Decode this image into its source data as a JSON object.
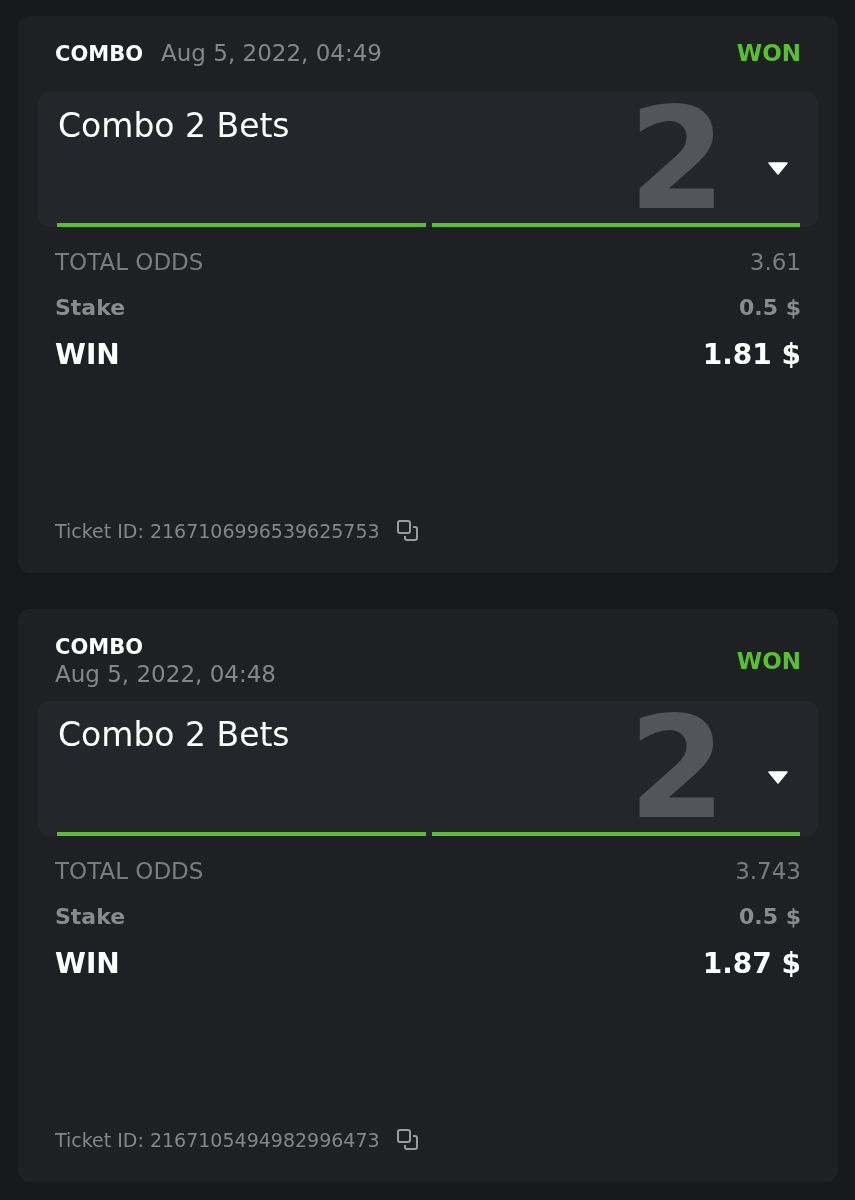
{
  "bets": [
    {
      "type": "COMBO",
      "date": "Aug 5, 2022, 04:49",
      "date_on_new_line": false,
      "status": "WON",
      "title": "Combo 2 Bets",
      "count": "2",
      "expanded": false,
      "legs": [
        {
          "won": true
        },
        {
          "won": true
        }
      ],
      "total_odds_label": "TOTAL ODDS",
      "total_odds": "3.61",
      "stake_label": "Stake",
      "stake": "0.5 $",
      "win_label": "WIN",
      "win": "1.81 $",
      "ticket": "Ticket ID: 2167106996539625753"
    },
    {
      "type": "COMBO",
      "date": "Aug 5, 2022, 04:48",
      "date_on_new_line": true,
      "status": "WON",
      "title": "Combo 2 Bets",
      "count": "2",
      "expanded": false,
      "legs": [
        {
          "won": true
        },
        {
          "won": true
        }
      ],
      "total_odds_label": "TOTAL ODDS",
      "total_odds": "3.743",
      "stake_label": "Stake",
      "stake": "0.5 $",
      "win_label": "WIN",
      "win": "1.87 $",
      "ticket": "Ticket ID: 2167105494982996473"
    }
  ]
}
